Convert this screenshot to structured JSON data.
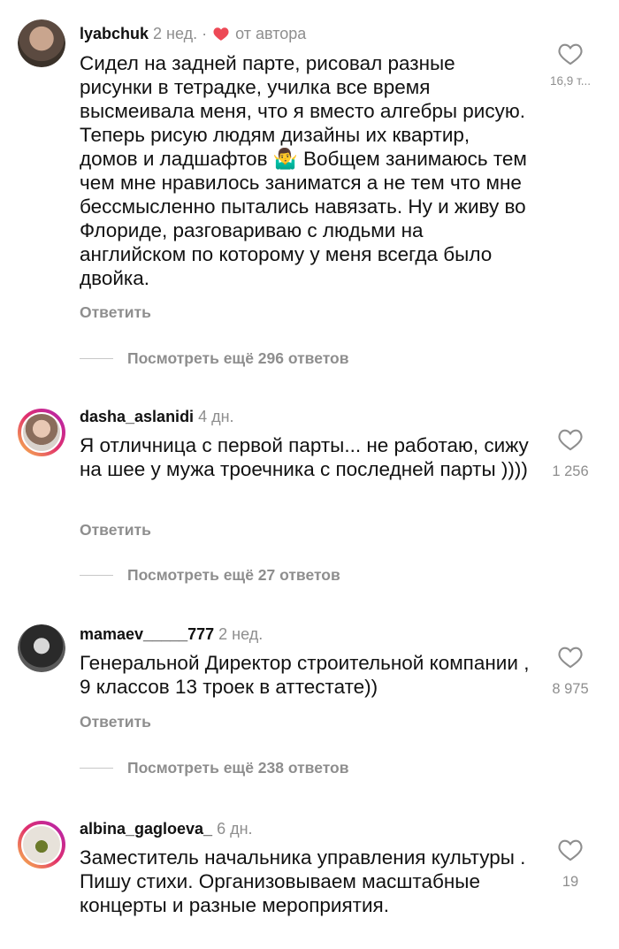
{
  "comments": [
    {
      "username": "lyabchuk",
      "time": "2 нед.",
      "separator": "·",
      "author_like": "от автора",
      "text": "Сидел на задней парте, рисовал разные рисунки в тетрадке, училка все время высмеивала меня, что я вместо алгебры рисую. Теперь рисую людям дизайны их квартир, домов и ладшафтов 🤷‍♂️ Вобщем занимаюсь тем чем мне нравилось заниматся а не тем что мне бессмысленно пытались навязать. Ну и живу во Флориде, разговариваю с людьми на английском по которому у меня всегда было двойка.",
      "likes": "16,9 т...",
      "reply_label": "Ответить",
      "view_more": "Посмотреть ещё 296 ответов"
    },
    {
      "username": "dasha_aslanidi",
      "time": "4 дн.",
      "text": "Я отличница с первой парты... не работаю, сижу на шее у мужа троечника с последней парты ))))",
      "likes": "1 256",
      "reply_label": "Ответить",
      "view_more": "Посмотреть ещё 27 ответов"
    },
    {
      "username": "mamaev_____777",
      "time": "2 нед.",
      "text": "Генеральной Директор строительной компании , 9 классов 13 троек в аттестате))",
      "likes": "8 975",
      "reply_label": "Ответить",
      "view_more": "Посмотреть ещё 238 ответов"
    },
    {
      "username": "albina_gagloeva_",
      "time": "6 дн.",
      "text": "Заместитель начальника управления культуры . Пишу стихи. Организовываем масштабные концерты и разные мероприятия.",
      "likes": "19"
    }
  ],
  "colors": {
    "text": "#111111",
    "meta": "#8e8e8e",
    "author_heart": "#ed4956",
    "story_ring": [
      "#f9c34a",
      "#e1306c",
      "#b022b4"
    ]
  },
  "icons": {
    "like": "heart-outline-icon",
    "author_like": "heart-filled-icon"
  }
}
